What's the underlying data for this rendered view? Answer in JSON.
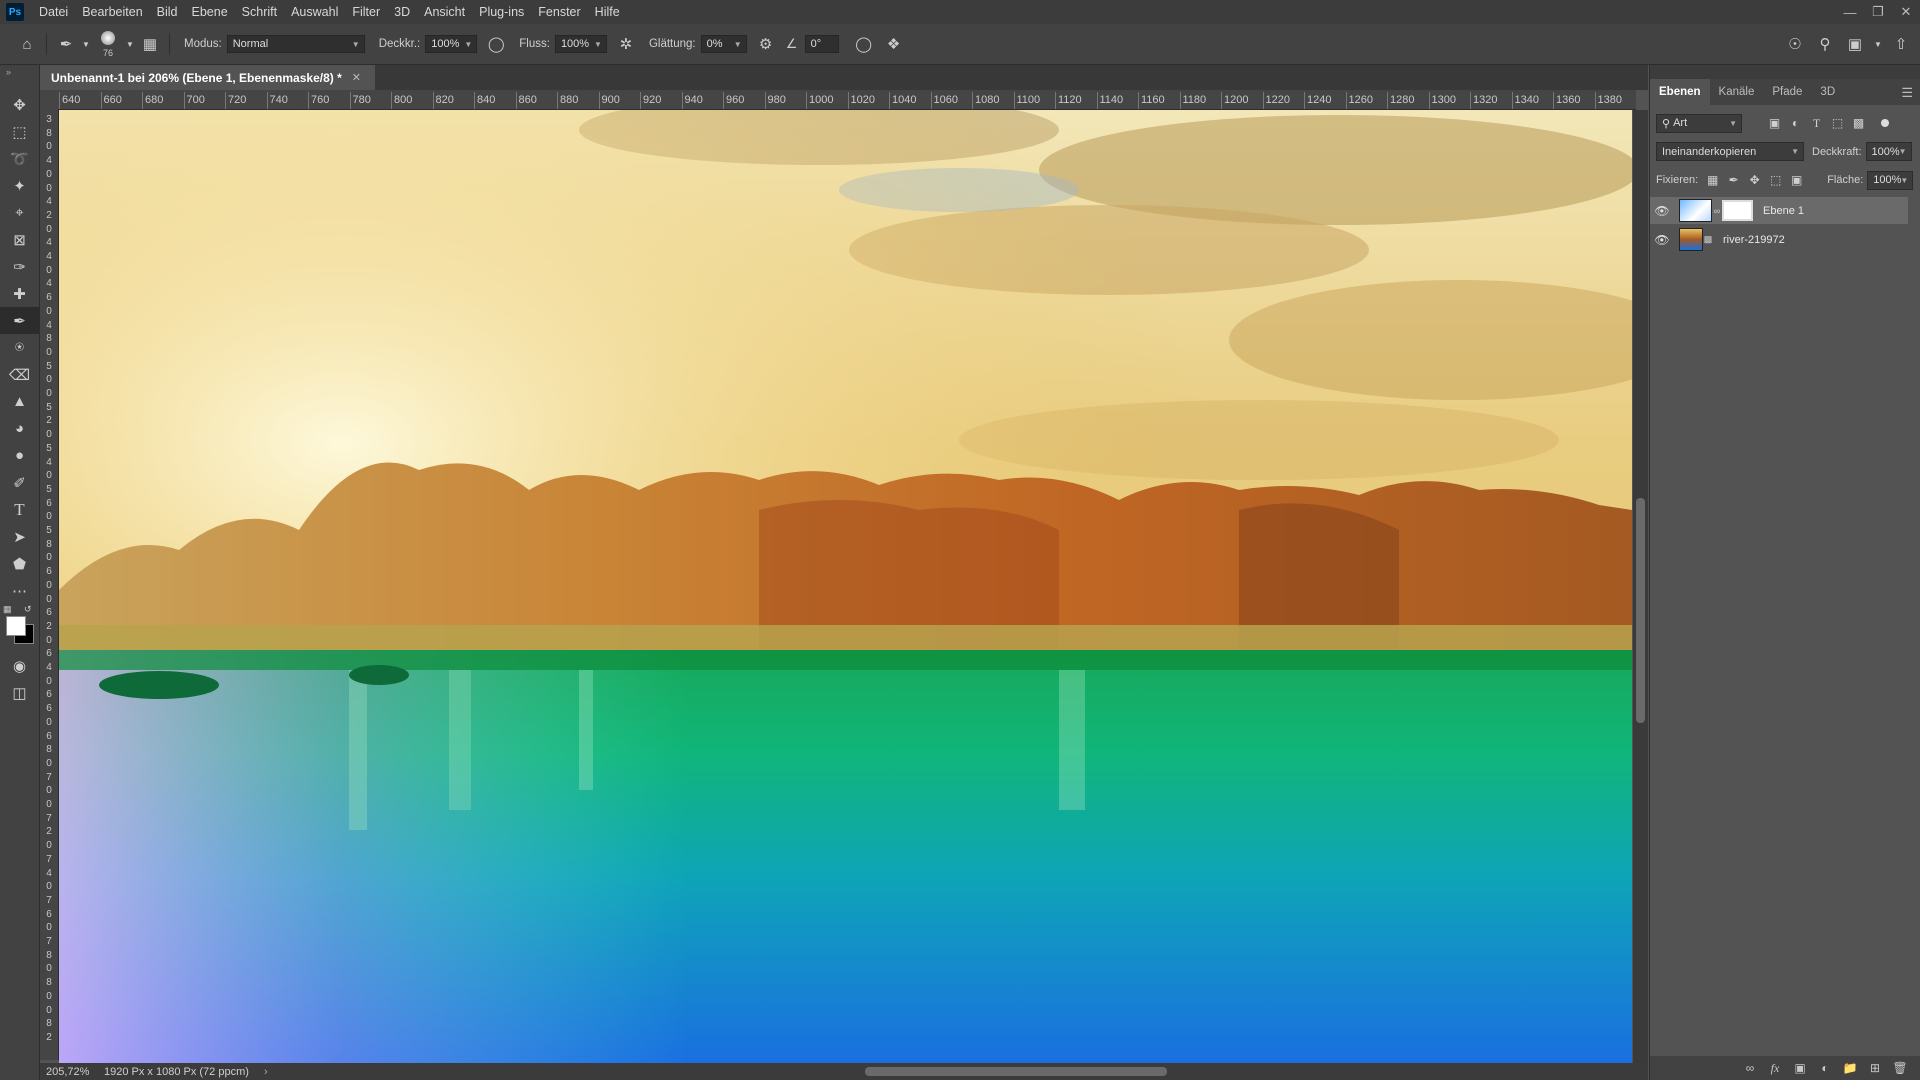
{
  "app": {
    "logo": "Ps"
  },
  "menu": [
    "Datei",
    "Bearbeiten",
    "Bild",
    "Ebene",
    "Schrift",
    "Auswahl",
    "Filter",
    "3D",
    "Ansicht",
    "Plug-ins",
    "Fenster",
    "Hilfe"
  ],
  "window_controls": [
    "minimize-icon",
    "restore-icon",
    "close-icon"
  ],
  "options": {
    "brush_size": "76",
    "mode_label": "Modus:",
    "mode_value": "Normal",
    "opacity_label": "Deckkr.:",
    "opacity_value": "100%",
    "flow_label": "Fluss:",
    "flow_value": "100%",
    "smoothing_label": "Glättung:",
    "smoothing_value": "0%",
    "angle_value": "0°"
  },
  "document": {
    "tab_title": "Unbenannt-1 bei 206% (Ebene 1, Ebenenmaske/8) *",
    "zoom": "205,72%",
    "info": "1920 Px x 1080 Px (72 ppcm)"
  },
  "ruler_top": [
    "640",
    "660",
    "680",
    "700",
    "720",
    "740",
    "760",
    "780",
    "800",
    "820",
    "840",
    "860",
    "880",
    "900",
    "920",
    "940",
    "960",
    "980",
    "1000",
    "1020",
    "1040",
    "1060",
    "1080",
    "1100",
    "1120",
    "1140",
    "1160",
    "1180",
    "1200",
    "1220",
    "1240",
    "1260",
    "1280",
    "1300",
    "1320",
    "1340",
    "1360",
    "1380"
  ],
  "ruler_left": [
    "3",
    "8",
    "0",
    "4",
    "0",
    "0",
    "4",
    "2",
    "0",
    "4",
    "4",
    "0",
    "4",
    "6",
    "0",
    "4",
    "8",
    "0",
    "5",
    "0",
    "0",
    "5",
    "2",
    "0",
    "5",
    "4",
    "0",
    "5",
    "6",
    "0",
    "5",
    "8",
    "0",
    "6",
    "0",
    "0",
    "6",
    "2",
    "0",
    "6",
    "4",
    "0",
    "6",
    "6",
    "0",
    "6",
    "8",
    "0",
    "7",
    "0",
    "0",
    "7",
    "2",
    "0",
    "7",
    "4",
    "0",
    "7",
    "6",
    "0",
    "7",
    "8",
    "0",
    "8",
    "0",
    "0",
    "8",
    "2"
  ],
  "panel": {
    "tabs": [
      "Ebenen",
      "Kanäle",
      "Pfade",
      "3D"
    ],
    "filter_value": "Art",
    "blend_mode": "Ineinanderkopieren",
    "opacity_label": "Deckkraft:",
    "opacity_value": "100%",
    "lock_label": "Fixieren:",
    "fill_label": "Fläche:",
    "fill_value": "100%",
    "layers": [
      {
        "name": "Ebene 1",
        "selected": true
      },
      {
        "name": "river-219972",
        "selected": false
      }
    ]
  },
  "colors": {
    "foreground": "#ffffff",
    "background": "#000000",
    "accent": "#31a8ff"
  }
}
